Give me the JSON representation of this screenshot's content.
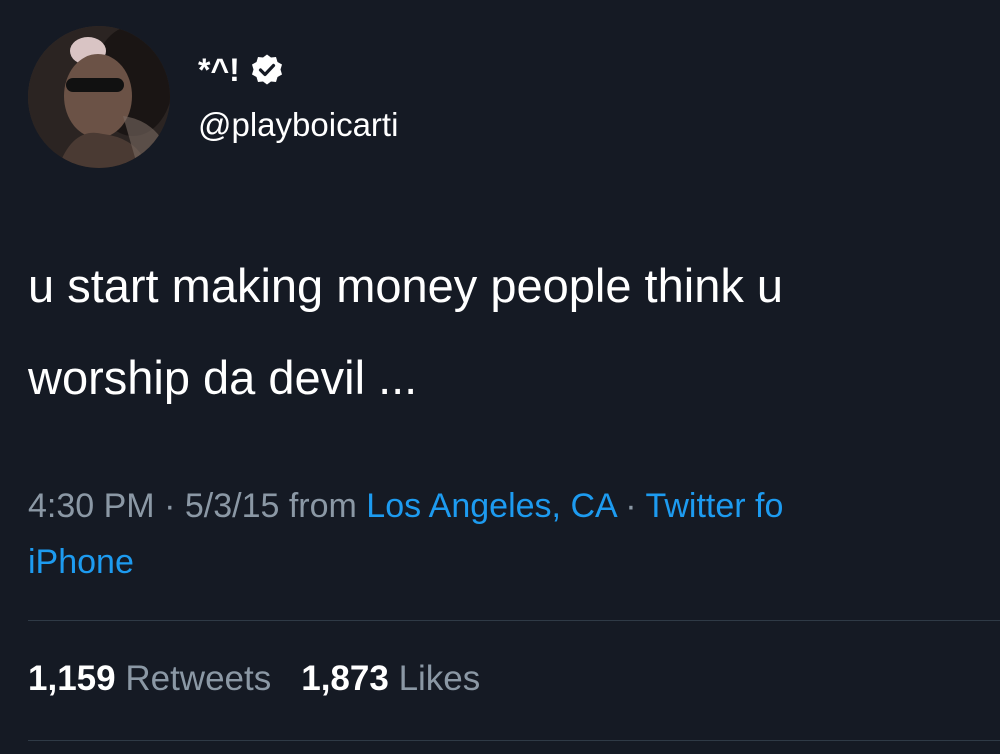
{
  "author": {
    "display_name": "*^!",
    "handle": "@playboicarti",
    "verified_icon": "verified-badge-icon",
    "avatar_icon": "profile-photo"
  },
  "tweet": {
    "text_lines": [
      "u start making money people think u",
      "worship da devil ..."
    ]
  },
  "meta": {
    "time": "4:30 PM",
    "separator": "·",
    "date": "5/3/15",
    "from_word": "from",
    "location": "Los Angeles, CA",
    "client_part1": "Twitter fo",
    "client_part2": "iPhone"
  },
  "stats": {
    "retweets_count": "1,159",
    "retweets_label": "Retweets",
    "likes_count": "1,873",
    "likes_label": "Likes"
  },
  "colors": {
    "background": "#151a24",
    "text_primary": "#ffffff",
    "text_secondary": "#8b98a5",
    "link": "#1d9bf0",
    "divider": "#2f3a46"
  }
}
